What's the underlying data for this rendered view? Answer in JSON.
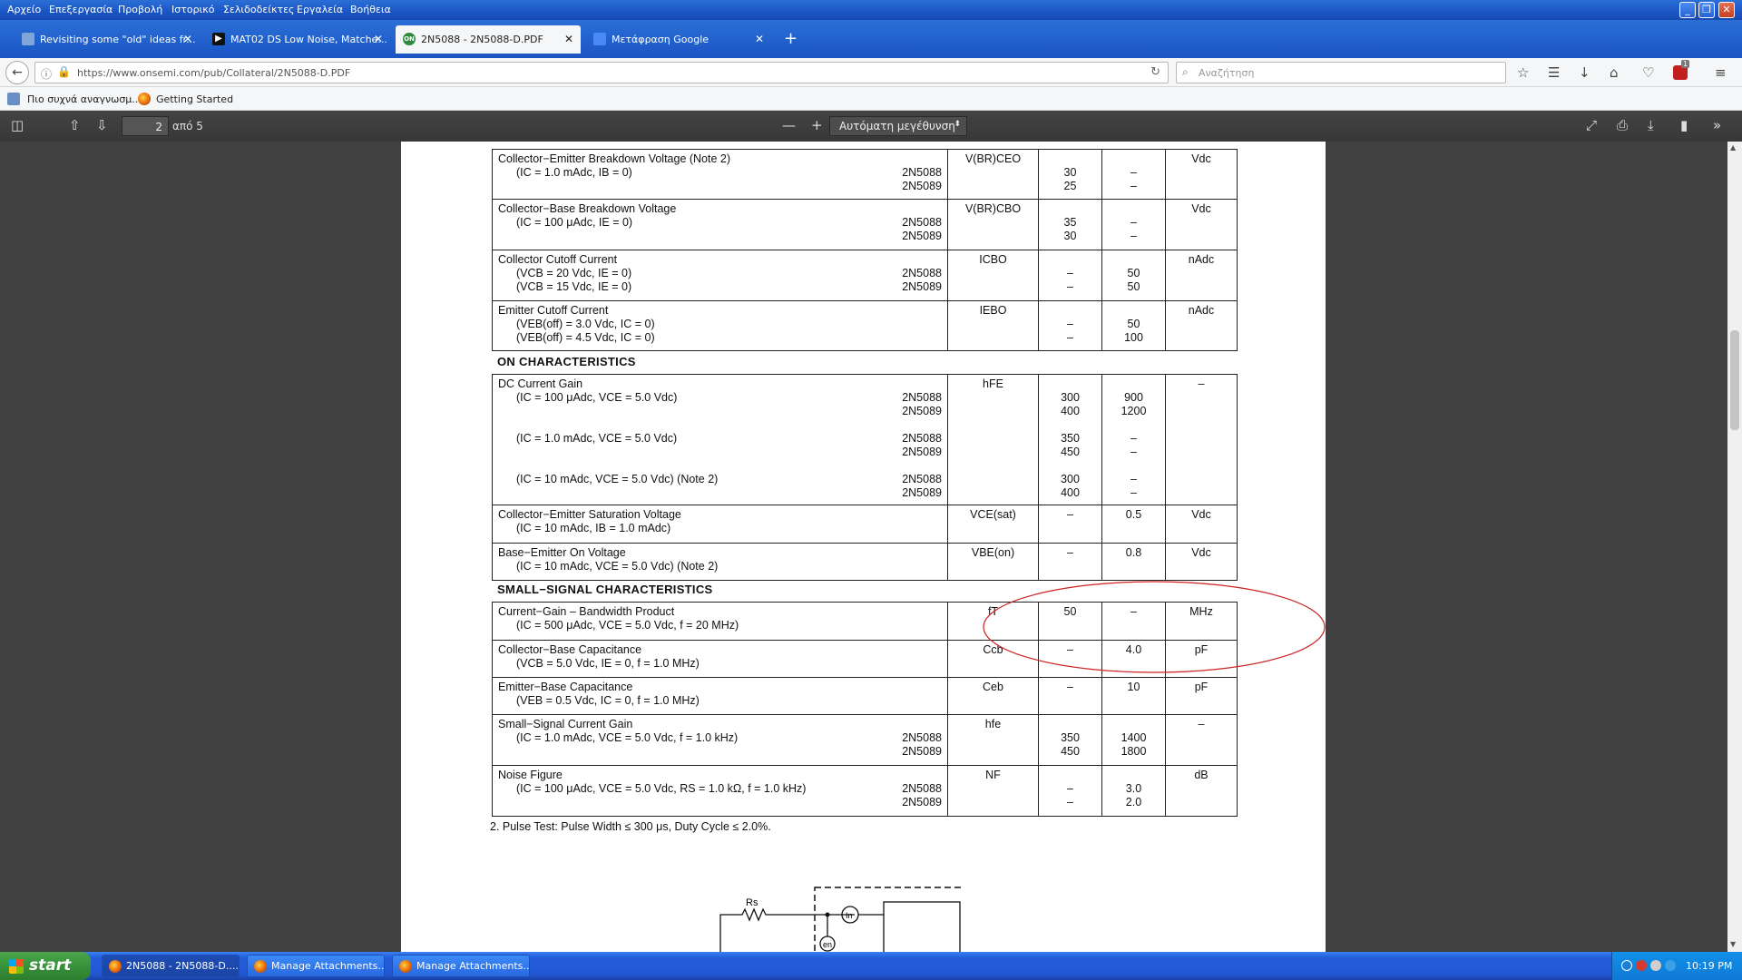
{
  "menubar": {
    "items": [
      "Αρχείο",
      "Επεξεργασία",
      "Προβολή",
      "Ιστορικό",
      "Σελιδοδείκτες",
      "Εργαλεία",
      "Βοήθεια"
    ]
  },
  "tabs": [
    {
      "label": "Revisiting some \"old\" ideas fr..."
    },
    {
      "label": "MAT02 DS Low Noise, Matche..."
    },
    {
      "label": "2N5088 - 2N5088-D.PDF",
      "favicon": "ON"
    },
    {
      "label": "Μετάφραση Google"
    }
  ],
  "navbar": {
    "url": "https://www.onsemi.com/pub/Collateral/2N5088-D.PDF",
    "search_placeholder": "Αναζήτηση",
    "badge": "1"
  },
  "bookmarks": [
    {
      "label": "Πιο συχνά αναγνωσμ..."
    },
    {
      "label": "Getting Started"
    }
  ],
  "pdf_toolbar": {
    "page_number": "2",
    "page_total": "από 5",
    "zoom": "Αυτόματη μεγέθυνση"
  },
  "datasheet": {
    "sections": {
      "on": "ON CHARACTERISTICS",
      "small_signal": "SMALL−SIGNAL CHARACTERISTICS"
    },
    "note": "2.  Pulse Test: Pulse Width ≤ 300 μs, Duty Cycle ≤ 2.0%.",
    "off_rows": [
      {
        "name": "Collector−Emitter Breakdown Voltage (Note 2)",
        "cond": "(IC = 1.0 mAdc, IB = 0)",
        "parts": [
          "2N5088",
          "2N5089"
        ],
        "symbol": "V(BR)CEO",
        "min": [
          "30",
          "25"
        ],
        "max": [
          "–",
          "–"
        ],
        "unit": "Vdc"
      },
      {
        "name": "Collector−Base Breakdown Voltage",
        "cond": "(IC = 100 μAdc, IE = 0)",
        "parts": [
          "2N5088",
          "2N5089"
        ],
        "symbol": "V(BR)CBO",
        "min": [
          "35",
          "30"
        ],
        "max": [
          "–",
          "–"
        ],
        "unit": "Vdc"
      },
      {
        "name": "Collector Cutoff Current",
        "conds": [
          "(VCB = 20 Vdc, IE = 0)",
          "(VCB = 15 Vdc, IE = 0)"
        ],
        "parts": [
          "2N5088",
          "2N5089"
        ],
        "symbol": "ICBO",
        "min": [
          "–",
          "–"
        ],
        "max": [
          "50",
          "50"
        ],
        "unit": "nAdc"
      },
      {
        "name": "Emitter Cutoff Current",
        "conds": [
          "(VEB(off) = 3.0 Vdc, IC = 0)",
          "(VEB(off) = 4.5 Vdc, IC = 0)"
        ],
        "symbol": "IEBO",
        "min": [
          "–",
          "–"
        ],
        "max": [
          "50",
          "100"
        ],
        "unit": "nAdc"
      }
    ],
    "on_rows": {
      "dc_gain": {
        "name": "DC Current Gain",
        "symbol": "hFE",
        "unit": "–",
        "groups": [
          {
            "cond": "(IC = 100 μAdc, VCE = 5.0 Vdc)",
            "parts": [
              "2N5088",
              "2N5089"
            ],
            "min": [
              "300",
              "400"
            ],
            "max": [
              "900",
              "1200"
            ]
          },
          {
            "cond": "(IC = 1.0 mAdc, VCE = 5.0 Vdc)",
            "parts": [
              "2N5088",
              "2N5089"
            ],
            "min": [
              "350",
              "450"
            ],
            "max": [
              "–",
              "–"
            ]
          },
          {
            "cond": "(IC = 10 mAdc, VCE = 5.0 Vdc) (Note 2)",
            "parts": [
              "2N5088",
              "2N5089"
            ],
            "min": [
              "300",
              "400"
            ],
            "max": [
              "–",
              "–"
            ]
          }
        ]
      },
      "vce_sat": {
        "name": "Collector−Emitter Saturation Voltage",
        "cond": "(IC = 10 mAdc, IB = 1.0 mAdc)",
        "symbol": "VCE(sat)",
        "min": "–",
        "max": "0.5",
        "unit": "Vdc"
      },
      "vbe_on": {
        "name": "Base−Emitter On Voltage",
        "cond": "(IC = 10 mAdc, VCE = 5.0 Vdc) (Note 2)",
        "symbol": "VBE(on)",
        "min": "–",
        "max": "0.8",
        "unit": "Vdc"
      }
    },
    "ss_rows": {
      "ft": {
        "name": "Current−Gain – Bandwidth Product",
        "cond": "(IC = 500 μAdc, VCE = 5.0 Vdc, f = 20 MHz)",
        "symbol": "fT",
        "min": "50",
        "max": "–",
        "unit": "MHz"
      },
      "ccb": {
        "name": "Collector−Base Capacitance",
        "cond": "(VCB = 5.0 Vdc, IE = 0, f = 1.0 MHz)",
        "symbol": "Ccb",
        "min": "–",
        "max": "4.0",
        "unit": "pF"
      },
      "ceb": {
        "name": "Emitter−Base Capacitance",
        "cond": "(VEB = 0.5 Vdc, IC = 0, f = 1.0 MHz)",
        "symbol": "Ceb",
        "min": "–",
        "max": "10",
        "unit": "pF"
      },
      "hfe": {
        "name": "Small−Signal Current Gain",
        "cond": "(IC = 1.0 mAdc, VCE = 5.0 Vdc, f = 1.0 kHz)",
        "parts": [
          "2N5088",
          "2N5089"
        ],
        "symbol": "hfe",
        "min": [
          "350",
          "450"
        ],
        "max": [
          "1400",
          "1800"
        ],
        "unit": "–"
      },
      "nf": {
        "name": "Noise Figure",
        "cond": "(IC = 100 μAdc, VCE = 5.0 Vdc, RS = 1.0 kΩ, f = 1.0 kHz)",
        "parts": [
          "2N5088",
          "2N5089"
        ],
        "symbol": "NF",
        "min": [
          "–",
          "–"
        ],
        "max": [
          "3.0",
          "2.0"
        ],
        "unit": "dB"
      }
    },
    "circuit": {
      "rs_label": "Rs",
      "in_label": "In",
      "en_label": "en"
    }
  },
  "taskbar": {
    "start": "start",
    "items": [
      "2N5088 - 2N5088-D....",
      "Manage Attachments...",
      "Manage Attachments..."
    ],
    "clock": "10:19 PM"
  },
  "colors": {
    "annotation": "#cc2222",
    "pdf_bg": "#404040",
    "xp_blue": "#245edb"
  }
}
